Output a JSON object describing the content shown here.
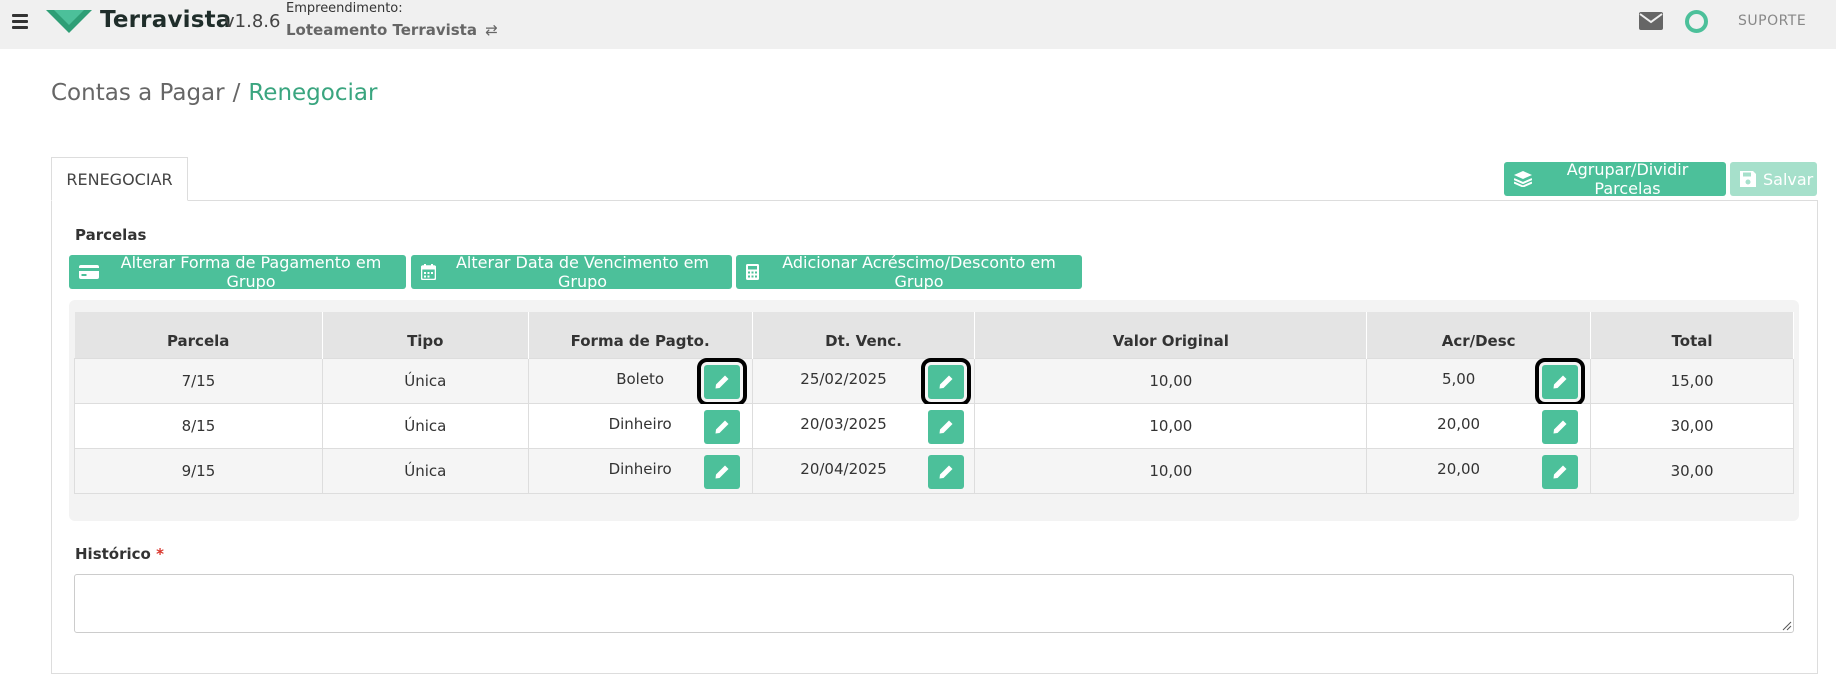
{
  "header": {
    "brand": "Terravista",
    "version": "v1.8.6",
    "empreendimento_label": "Empreendimento:",
    "empreendimento_name": "Loteamento Terravista",
    "swap_glyph": "⇄",
    "support_label": "SUPORTE",
    "status_color": "#4cc09a"
  },
  "breadcrumb": {
    "parent": "Contas a Pagar",
    "separator": "/",
    "current": "Renegociar"
  },
  "tabs": [
    {
      "label": "RENEGOCIAR"
    }
  ],
  "actions": {
    "agrupar_label": "Agrupar/Dividir Parcelas",
    "salvar_label": "Salvar"
  },
  "parcelas": {
    "title": "Parcelas",
    "group_buttons": [
      {
        "label": "Alterar Forma de Pagamento em Grupo",
        "icon": "credit-card-icon"
      },
      {
        "label": "Alterar Data de Vencimento em Grupo",
        "icon": "calendar-icon"
      },
      {
        "label": "Adicionar Acréscimo/Desconto em Grupo",
        "icon": "calculator-icon"
      }
    ],
    "columns": [
      "Parcela",
      "Tipo",
      "Forma de Pagto.",
      "Dt. Venc.",
      "Valor Original",
      "Acr/Desc",
      "Total"
    ],
    "rows": [
      {
        "parcela": "7/15",
        "tipo": "Única",
        "forma": "Boleto",
        "venc": "25/02/2025",
        "valor": "10,00",
        "acr": "5,00",
        "total": "15,00"
      },
      {
        "parcela": "8/15",
        "tipo": "Única",
        "forma": "Dinheiro",
        "venc": "20/03/2025",
        "valor": "10,00",
        "acr": "20,00",
        "total": "30,00"
      },
      {
        "parcela": "9/15",
        "tipo": "Única",
        "forma": "Dinheiro",
        "venc": "20/04/2025",
        "valor": "10,00",
        "acr": "20,00",
        "total": "30,00"
      }
    ]
  },
  "historico": {
    "label": "Histórico",
    "required_mark": "*",
    "value": ""
  },
  "colors": {
    "accent": "#4cc09a",
    "accent_light": "#a6e0cb",
    "breadcrumb_active": "#3aa57f"
  }
}
